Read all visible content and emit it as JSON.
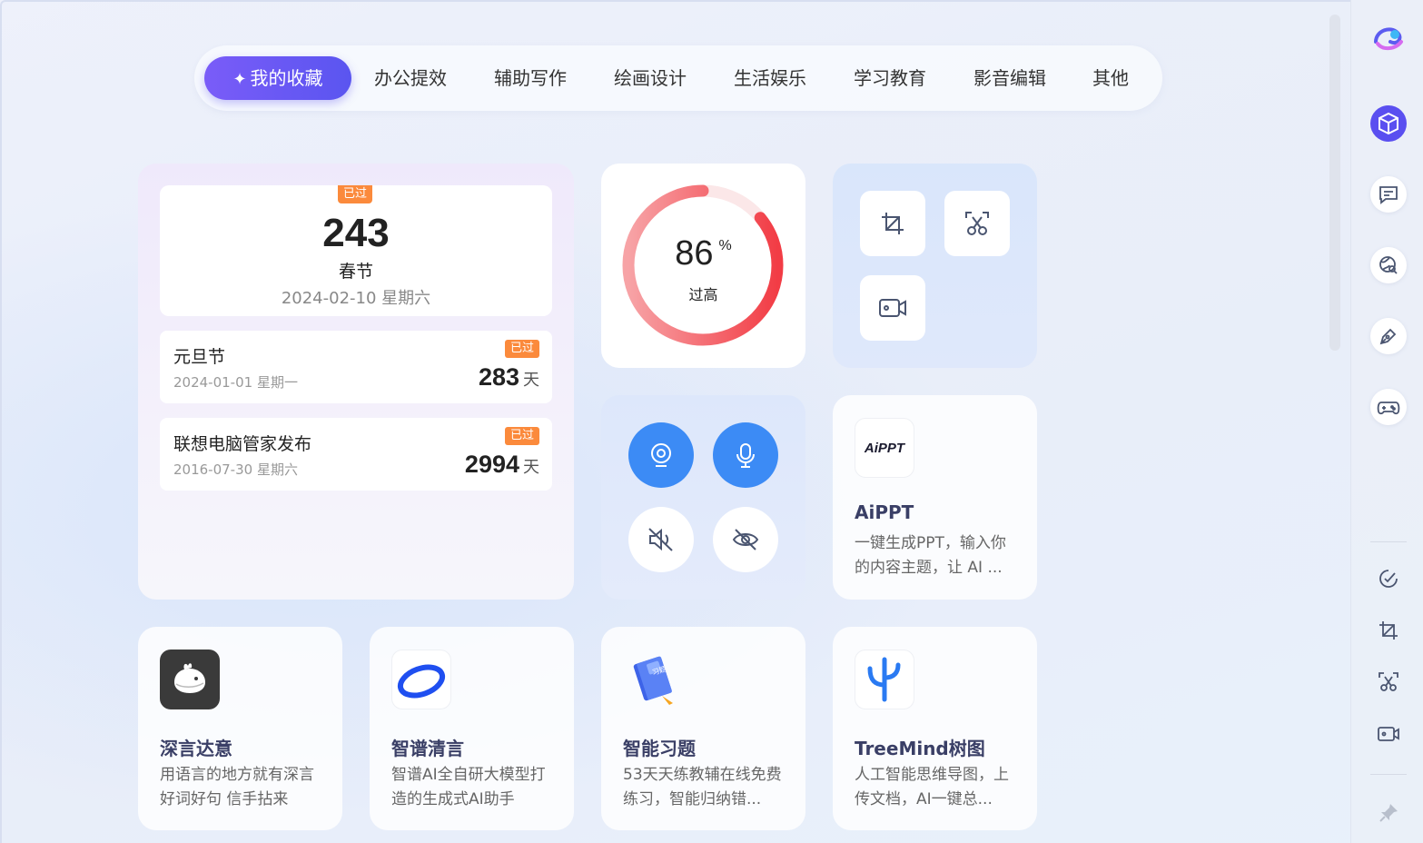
{
  "tabs": [
    {
      "label": "我的收藏",
      "active": true
    },
    {
      "label": "办公提效"
    },
    {
      "label": "辅助写作"
    },
    {
      "label": "绘画设计"
    },
    {
      "label": "生活娱乐"
    },
    {
      "label": "学习教育"
    },
    {
      "label": "影音编辑"
    },
    {
      "label": "其他"
    }
  ],
  "countdown": {
    "main": {
      "badge": "已过",
      "days": "243",
      "name": "春节",
      "date": "2024-02-10 星期六"
    },
    "items": [
      {
        "name": "元旦节",
        "date": "2024-01-01 星期一",
        "badge": "已过",
        "days": "283",
        "unit": "天"
      },
      {
        "name": "联想电脑管家发布",
        "date": "2016-07-30 星期六",
        "badge": "已过",
        "days": "2994",
        "unit": "天"
      }
    ]
  },
  "gauge": {
    "value": "86",
    "unit": "%",
    "label": "过高",
    "color": "#f24a52"
  },
  "tools": {
    "icons": [
      "crop-icon",
      "screenshot-scissors-icon",
      "screen-record-icon"
    ]
  },
  "media": {
    "icons": [
      "camera-icon",
      "microphone-icon",
      "speaker-mute-icon",
      "eye-off-icon"
    ],
    "accent": "#3c8bf5"
  },
  "apps": [
    {
      "title": "AiPPT",
      "desc": "一键生成PPT，输入你的内容主题，让 AI ...",
      "icon": "aippt-logo",
      "icon_text": "AiPPT"
    },
    {
      "title": "深言达意",
      "desc": "用语言的地方就有深言 好词好句 信手拈来",
      "icon": "whale-logo"
    },
    {
      "title": "智谱清言",
      "desc": "智谱AI全自研大模型打造的生成式AI助手",
      "icon": "zhipu-ring-logo"
    },
    {
      "title": "智能习题",
      "desc": "53天天练教辅在线免费练习，智能归纳错...",
      "icon": "notebook-logo",
      "icon_text": "习题"
    },
    {
      "title": "TreeMind树图",
      "desc": "人工智能思维导图，上传文档，AI一键总...",
      "icon": "treemind-logo"
    }
  ],
  "sidebar": {
    "icons": [
      "app-logo-icon",
      "cube-icon",
      "chat-icon",
      "globe-search-icon",
      "pen-icon",
      "gamepad-icon",
      "speed-check-icon",
      "crop-icon",
      "screenshot-scissors-icon",
      "screen-record-icon",
      "pin-icon"
    ]
  }
}
